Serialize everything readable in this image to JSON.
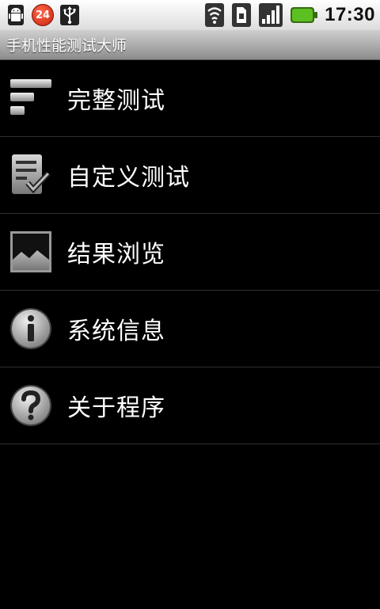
{
  "status_bar": {
    "notification_count": "24",
    "time": "17:30",
    "icons": [
      "android-debug-icon",
      "notification-badge",
      "usb-icon",
      "wifi-icon",
      "sim-card-icon",
      "signal-icon",
      "battery-icon"
    ]
  },
  "title_bar": {
    "title": "手机性能测试大师"
  },
  "menu": {
    "items": [
      {
        "label": "完整测试",
        "icon": "bars-icon"
      },
      {
        "label": "自定义测试",
        "icon": "checklist-icon"
      },
      {
        "label": "结果浏览",
        "icon": "picture-icon"
      },
      {
        "label": "系统信息",
        "icon": "info-icon"
      },
      {
        "label": "关于程序",
        "icon": "help-icon"
      }
    ]
  },
  "colors": {
    "background": "#000000",
    "status_bar": "#e8e8e8",
    "title_bar": "#a8a8a8",
    "divider": "#2f2f2f",
    "badge": "#e03a1c",
    "battery": "#5cc020"
  }
}
